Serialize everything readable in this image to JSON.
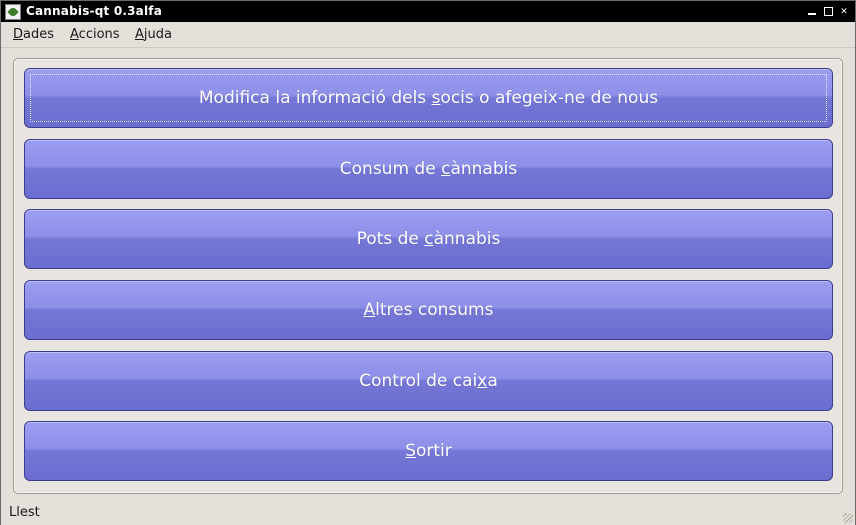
{
  "window": {
    "title": "Cannabis-qt 0.3alfa",
    "icon": "cannabis-leaf-icon"
  },
  "menubar": {
    "items": [
      {
        "pre": "",
        "mnemonic": "D",
        "post": "ades"
      },
      {
        "pre": "",
        "mnemonic": "A",
        "post": "ccions"
      },
      {
        "pre": "",
        "mnemonic": "A",
        "post": "juda"
      }
    ]
  },
  "buttons": [
    {
      "pre": "Modifica la informació dels ",
      "mnemonic": "s",
      "post": "ocis o afegeix-ne de nous"
    },
    {
      "pre": "Consum de ",
      "mnemonic": "c",
      "post": "ànnabis"
    },
    {
      "pre": "Pots de ",
      "mnemonic": "c",
      "post": "ànnabis"
    },
    {
      "pre": "",
      "mnemonic": "A",
      "post": "ltres consums"
    },
    {
      "pre": "Control de cai",
      "mnemonic": "x",
      "post": "a"
    },
    {
      "pre": "",
      "mnemonic": "S",
      "post": "ortir"
    }
  ],
  "statusbar": {
    "text": "Llest"
  },
  "colors": {
    "button_top": "#9c9ef3",
    "button_bottom": "#6b6ecf",
    "button_border": "#3b3d8f",
    "window_bg": "#e3dfd9",
    "titlebar_bg": "#000000"
  }
}
